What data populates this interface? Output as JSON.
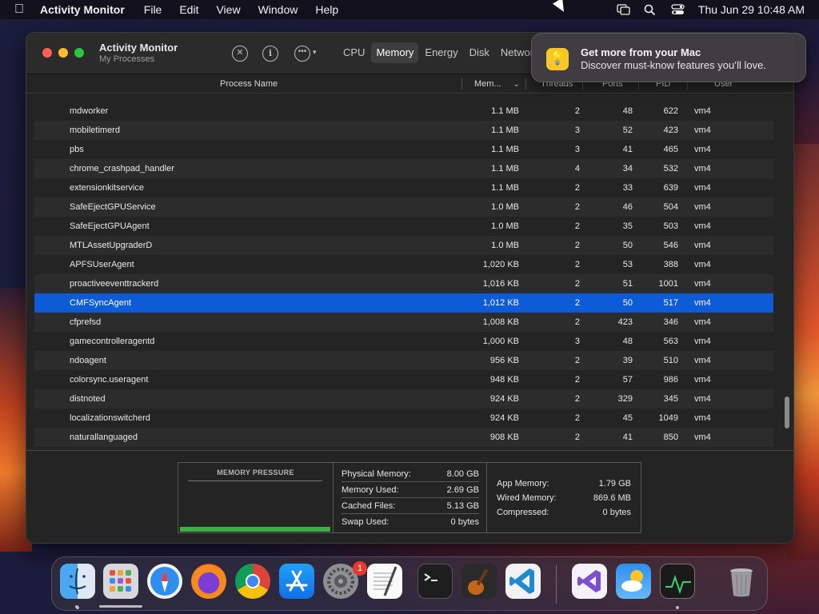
{
  "menubar": {
    "app_name": "Activity Monitor",
    "menus": [
      "File",
      "Edit",
      "View",
      "Window",
      "Help"
    ],
    "datetime": "Thu Jun 29  10:48 AM"
  },
  "window": {
    "title": "Activity Monitor",
    "subtitle": "My Processes",
    "tabs": [
      "CPU",
      "Memory",
      "Energy",
      "Disk",
      "Networ"
    ],
    "active_tab": "Memory"
  },
  "table": {
    "columns": [
      "Process Name",
      "Mem...",
      "Threads",
      "Ports",
      "PID",
      "User"
    ],
    "rows": [
      {
        "name": "mdworker",
        "mem": "1.1 MB",
        "threads": "2",
        "ports": "48",
        "pid": "622",
        "user": "vm4"
      },
      {
        "name": "mobiletimerd",
        "mem": "1.1 MB",
        "threads": "3",
        "ports": "52",
        "pid": "423",
        "user": "vm4"
      },
      {
        "name": "pbs",
        "mem": "1.1 MB",
        "threads": "3",
        "ports": "41",
        "pid": "465",
        "user": "vm4"
      },
      {
        "name": "chrome_crashpad_handler",
        "mem": "1.1 MB",
        "threads": "4",
        "ports": "34",
        "pid": "532",
        "user": "vm4"
      },
      {
        "name": "extensionkitservice",
        "mem": "1.1 MB",
        "threads": "2",
        "ports": "33",
        "pid": "639",
        "user": "vm4"
      },
      {
        "name": "SafeEjectGPUService",
        "mem": "1.0 MB",
        "threads": "2",
        "ports": "46",
        "pid": "504",
        "user": "vm4"
      },
      {
        "name": "SafeEjectGPUAgent",
        "mem": "1.0 MB",
        "threads": "2",
        "ports": "35",
        "pid": "503",
        "user": "vm4"
      },
      {
        "name": "MTLAssetUpgraderD",
        "mem": "1.0 MB",
        "threads": "2",
        "ports": "50",
        "pid": "546",
        "user": "vm4"
      },
      {
        "name": "APFSUserAgent",
        "mem": "1,020 KB",
        "threads": "2",
        "ports": "53",
        "pid": "388",
        "user": "vm4"
      },
      {
        "name": "proactiveeventtrackerd",
        "mem": "1,016 KB",
        "threads": "2",
        "ports": "51",
        "pid": "1001",
        "user": "vm4"
      },
      {
        "name": "CMFSyncAgent",
        "mem": "1,012 KB",
        "threads": "2",
        "ports": "50",
        "pid": "517",
        "user": "vm4",
        "selected": true
      },
      {
        "name": "cfprefsd",
        "mem": "1,008 KB",
        "threads": "2",
        "ports": "423",
        "pid": "346",
        "user": "vm4"
      },
      {
        "name": "gamecontrolleragentd",
        "mem": "1,000 KB",
        "threads": "3",
        "ports": "48",
        "pid": "563",
        "user": "vm4"
      },
      {
        "name": "ndoagent",
        "mem": "956 KB",
        "threads": "2",
        "ports": "39",
        "pid": "510",
        "user": "vm4"
      },
      {
        "name": "colorsync.useragent",
        "mem": "948 KB",
        "threads": "2",
        "ports": "57",
        "pid": "986",
        "user": "vm4"
      },
      {
        "name": "distnoted",
        "mem": "924 KB",
        "threads": "2",
        "ports": "329",
        "pid": "345",
        "user": "vm4"
      },
      {
        "name": "localizationswitcherd",
        "mem": "924 KB",
        "threads": "2",
        "ports": "45",
        "pid": "1049",
        "user": "vm4"
      },
      {
        "name": "naturallanguaged",
        "mem": "908 KB",
        "threads": "2",
        "ports": "41",
        "pid": "850",
        "user": "vm4"
      }
    ]
  },
  "memory_panel": {
    "pressure_title": "MEMORY PRESSURE",
    "pressure_color": "#3cb043",
    "stats": [
      {
        "label": "Physical Memory:",
        "value": "8.00 GB"
      },
      {
        "label": "Memory Used:",
        "value": "2.69 GB"
      },
      {
        "label": "Cached Files:",
        "value": "5.13 GB"
      },
      {
        "label": "Swap Used:",
        "value": "0 bytes"
      }
    ],
    "breakdown": [
      {
        "label": "App Memory:",
        "value": "1.79 GB"
      },
      {
        "label": "Wired Memory:",
        "value": "869.6 MB"
      },
      {
        "label": "Compressed:",
        "value": "0 bytes"
      }
    ]
  },
  "notification": {
    "title": "Get more from your Mac",
    "body": "Discover must-know features you’ll love."
  },
  "dock": {
    "apps": [
      "finder-icon",
      "launchpad-icon",
      "safari-icon",
      "firefox-icon",
      "chrome-icon",
      "app-store-icon",
      "system-settings-icon",
      "textedit-icon",
      "terminal-icon",
      "garageband-icon",
      "vscode-icon",
      "visual-studio-icon",
      "weather-icon",
      "activity-monitor-icon",
      "trash-icon"
    ],
    "settings_badge": "1"
  },
  "colors": {
    "selection": "#0d5bd7",
    "close": "#fe5f57",
    "minimize": "#febc2e",
    "maximize": "#28c840"
  }
}
